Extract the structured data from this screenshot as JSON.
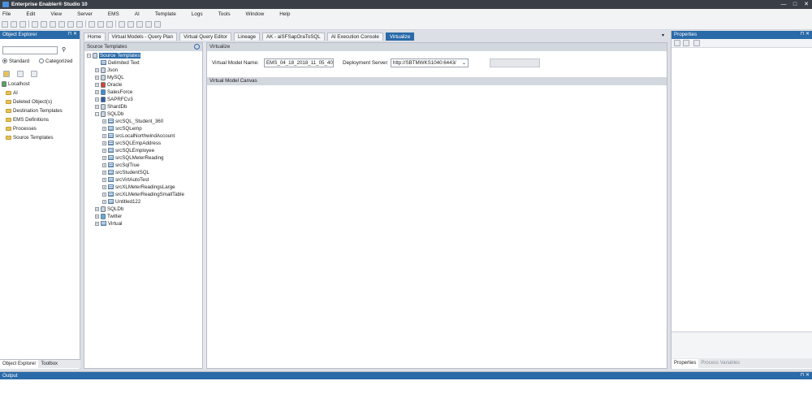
{
  "window": {
    "title": "Enterprise Enabler® Studio 10"
  },
  "menu": [
    "File",
    "Edit",
    "View",
    "Server",
    "EMS",
    "AI",
    "Template",
    "Logs",
    "Tools",
    "Window",
    "Help"
  ],
  "object_explorer": {
    "title": "Object Explorer",
    "radio_standard": "Standard",
    "radio_categorized": "Categorized",
    "tree": [
      "Localhost",
      "AI",
      "Deleted Object(s)",
      "Destination Templates",
      "EMS Definitions",
      "Processes",
      "Source Templates"
    ]
  },
  "bottom_tabs": [
    "Object Explorer",
    "Toolbox"
  ],
  "doc_tabs": [
    "Home",
    "Virtual Models - Query Plan",
    "Virtual Query Editor",
    "Lineage",
    "AK - aiSFSapOraToSQL",
    "AI Execution Console",
    "Virtualize"
  ],
  "source_templates": {
    "title": "Source Templates",
    "root": "Source Templates",
    "items": [
      "Delimited Text",
      "Json",
      "MySQL",
      "Oracle",
      "SalesForce",
      "SAPRFCv3",
      "ShardDb",
      "SQLDb"
    ],
    "sqldb_children": [
      "srcSQL_Student_360",
      "srcSQLemp",
      "srcLocalNorthwindAccount",
      "srcSQLEmpAddress",
      "srcSQLEmployee",
      "srcSQLMeterReading",
      "srcSqlTrue",
      "srcStudentSQL",
      "srcVirtAutoTest",
      "srcXLMeterReadingsLarge",
      "srcXLMeterReadingSmallTable",
      "Untitled122"
    ],
    "tail": [
      "SQLDb",
      "Twitter",
      "Virtual"
    ]
  },
  "virtualize": {
    "title": "Virtualize",
    "model_name_label": "Virtual Model Name:",
    "model_name_value": "EMS_04_18_2018_11_05_40",
    "server_label": "Deployment Server:",
    "server_value": "http://SBTMWKS1040:6443/",
    "canvas_title": "Virtual Model Canvas"
  },
  "properties": {
    "title": "Properties",
    "tabs": [
      "Properties",
      "Process Variables"
    ]
  },
  "output": {
    "title": "Output"
  }
}
